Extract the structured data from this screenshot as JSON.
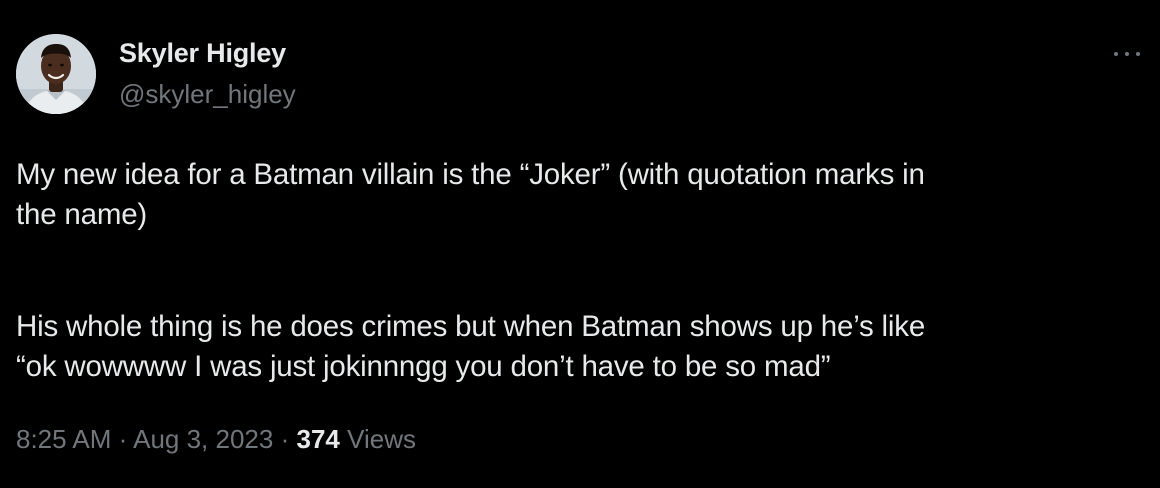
{
  "author": {
    "display_name": "Skyler Higley",
    "handle": "@skyler_higley",
    "avatar_icon": "user-portrait-avatar"
  },
  "tweet": {
    "lines": [
      "My new idea for a Batman villain is the “Joker” (with quotation marks in",
      "the name)",
      "His whole thing is he does crimes but when Batman shows up he’s like",
      "“ok wowwww I was just jokinnngg you don’t have to be so mad”"
    ]
  },
  "meta": {
    "time": "8:25 AM",
    "separator": "·",
    "date": "Aug 3, 2023",
    "views_count": "374",
    "views_label": "Views"
  },
  "colors": {
    "background": "#000000",
    "primary_text": "#e7e9ea",
    "secondary_text": "#71767b"
  }
}
